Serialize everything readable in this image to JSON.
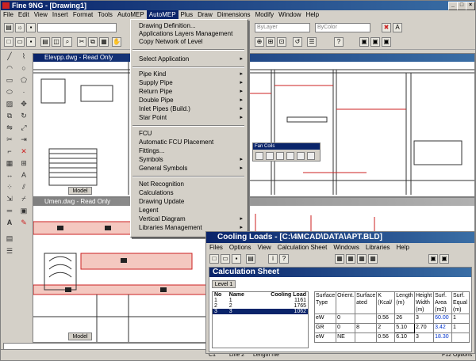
{
  "app": {
    "title": "Fine 9NG - [Drawing1]",
    "colors": {
      "titlebar": "#0a246a",
      "accent_red": "#cc2222",
      "pipe_fill": "#f4c8c0"
    }
  },
  "menubar": [
    "File",
    "Edit",
    "View",
    "Insert",
    "Format",
    "Tools",
    "AutoMEP",
    "AutoMEP",
    "Plus",
    "Draw",
    "Dimensions",
    "Modify",
    "Window",
    "Help"
  ],
  "toolbar": {
    "combo1": "ByLayer",
    "combo2": "ByColor"
  },
  "windows": {
    "top": {
      "title": "Elevpp.dwg - Read Only"
    },
    "bottom": {
      "title": "Umen.dwg - Read Only"
    },
    "model_tab": "Model",
    "fancoils": {
      "title": "Fan Coils"
    }
  },
  "dropdown": {
    "items": [
      {
        "label": "Drawing Definition...",
        "arrow": ""
      },
      {
        "label": "Applications Layers Management",
        "arrow": ""
      },
      {
        "label": "Copy Network of Level",
        "arrow": ""
      },
      {
        "label": "Select Application",
        "arrow": "▸"
      },
      {
        "label": "Pipe Kind",
        "arrow": "▸"
      },
      {
        "label": "Supply Pipe",
        "arrow": "▸"
      },
      {
        "label": "Return Pipe",
        "arrow": "▸"
      },
      {
        "label": "Double Pipe",
        "arrow": "▸"
      },
      {
        "label": "Inlet Pipes (Build.)",
        "arrow": "▸"
      },
      {
        "label": "Star Point",
        "arrow": "▸"
      },
      {
        "label": "FCU",
        "arrow": ""
      },
      {
        "label": "Automatic FCU Placement",
        "arrow": ""
      },
      {
        "label": "Fittings...",
        "arrow": ""
      },
      {
        "label": "Symbols",
        "arrow": "▸"
      },
      {
        "label": "General Symbols",
        "arrow": "▸"
      },
      {
        "label": "Net Recognition",
        "arrow": ""
      },
      {
        "label": "Calculations",
        "arrow": ""
      },
      {
        "label": "Drawing Update",
        "arrow": ""
      },
      {
        "label": "Legent",
        "arrow": ""
      },
      {
        "label": "Vertical Diagram",
        "arrow": "▸"
      },
      {
        "label": "Libraries Management",
        "arrow": "▸"
      }
    ]
  },
  "cooling": {
    "title": "Cooling Loads - [C:\\4MCAD\\DATA\\APT.BLD]",
    "menu": [
      "Files",
      "Options",
      "View",
      "Calculation Sheet",
      "Windows",
      "Libraries",
      "Help"
    ],
    "sheet_title": "Calculation Sheet",
    "tab": "Level 1",
    "level_headers": [
      "No",
      "Name",
      "Cooling Load"
    ],
    "level_rows": [
      {
        "no": "1",
        "name": "1",
        "load": "1161"
      },
      {
        "no": "2",
        "name": "2",
        "load": "1765"
      },
      {
        "no": "3",
        "name": "3",
        "load": "1062"
      }
    ],
    "calc_headers": [
      "Surface Type",
      "Orient.",
      "Surface ated",
      "K (Kcal/",
      "Length (m)",
      "Height Width (m)",
      "Surf. Area (m2)",
      "Surf. Equal (m)"
    ],
    "calc_rows": [
      [
        "eW",
        "0",
        "",
        "0.56",
        "26",
        "3",
        "60.00",
        "1"
      ],
      [
        "GR",
        "0",
        "8",
        "2",
        "5.10",
        "2.70",
        "3.42",
        "1"
      ],
      [
        "eW",
        "NE",
        "",
        "0.56",
        "6.10",
        "3",
        "18.30",
        ""
      ]
    ]
  },
  "status": {
    "left": "C1",
    "mid1": "Line 2",
    "mid2": "Length me",
    "right": "F12 Options"
  }
}
